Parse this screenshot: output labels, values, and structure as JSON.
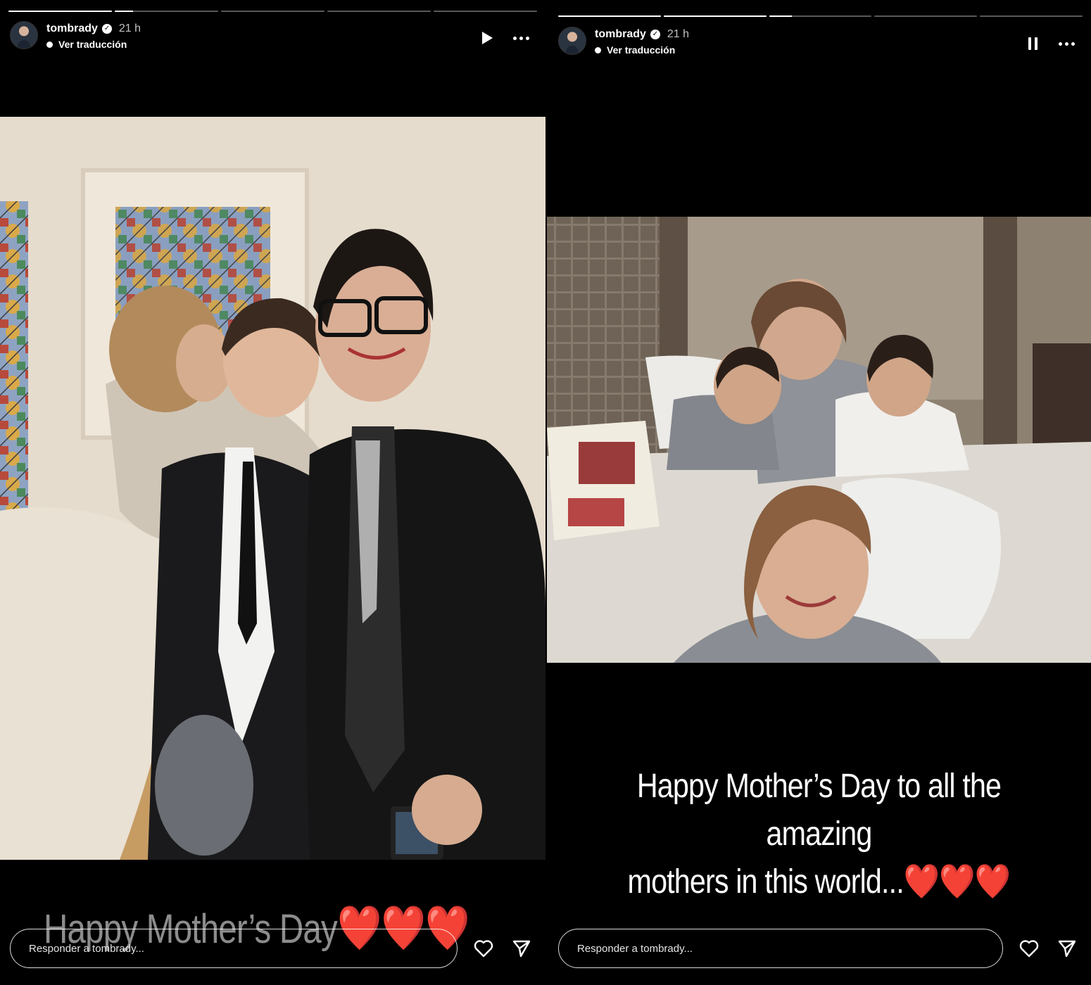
{
  "stories": [
    {
      "id": "left",
      "username": "tombrady",
      "time": "21 h",
      "translate": "Ver traducción",
      "playback_state": "paused",
      "progress_fractions": [
        1,
        0.18,
        0,
        0,
        0
      ],
      "photo_description": "Woman kissing a boy in a suit next to a smiling woman in glasses, stained glass window behind",
      "caption": "Happy Mother’s Day",
      "caption_hearts": "❤️❤️❤️",
      "reply_placeholder": "Responder a tombrady..."
    },
    {
      "id": "right",
      "username": "tombrady",
      "time": "21 h",
      "translate": "Ver traducción",
      "playback_state": "playing",
      "progress_fractions": [
        1,
        1,
        0.22,
        0,
        0
      ],
      "photo_description": "Mother in bed with two boys, girl smiling in foreground, open picture book",
      "caption_line1": "Happy Mother’s Day to all the amazing",
      "caption_line2": "mothers in this world...",
      "caption_hearts": "❤️❤️❤️",
      "reply_placeholder": "Responder a tombrady..."
    }
  ],
  "icons": {
    "verified": "verified-badge-icon",
    "play": "play-icon",
    "pause": "pause-icon",
    "more": "more-options-icon",
    "like": "heart-icon",
    "share": "send-icon"
  },
  "colors": {
    "background": "#000000",
    "heart_emoji": "#e3222c"
  }
}
